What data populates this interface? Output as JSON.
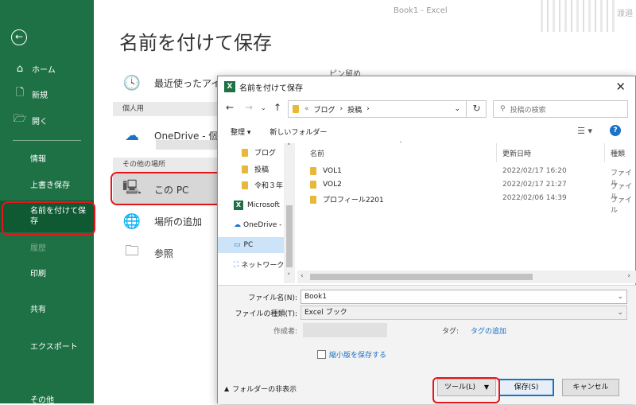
{
  "window_title": "Book1  -  Excel",
  "top_right_text": "渡邉",
  "page_title": "名前を付けて保存",
  "sidebar": {
    "home": "ホーム",
    "new": "新規",
    "open": "開く",
    "info": "情報",
    "overwrite": "上書き保存",
    "save_as": "名前を付けて保\n存",
    "history": "履歴",
    "print": "印刷",
    "share": "共有",
    "export": "エクスポート",
    "other": "その他"
  },
  "locations": {
    "recent": "最近使ったアイテム",
    "personal_header": "個人用",
    "onedrive": "OneDrive - 個人用",
    "other_header": "その他の場所",
    "this_pc": "この PC",
    "add_place": "場所の追加",
    "browse": "参照",
    "pin_label": "ピン留め"
  },
  "dialog": {
    "title": "名前を付けて保存",
    "path": [
      "«",
      "ブログ",
      "投稿"
    ],
    "search_placeholder": "投稿の検索",
    "toolbar": {
      "organize": "整理 ▾",
      "new_folder": "新しいフォルダー"
    },
    "tree": [
      "ブログ",
      "投稿",
      "令和３年",
      "Microsoft",
      "OneDrive -",
      "PC",
      "ネットワーク"
    ],
    "columns": {
      "name": "名前",
      "date": "更新日時",
      "type": "種類"
    },
    "files": [
      {
        "name": "VOL1",
        "date": "2022/02/17 16:20",
        "type": "ファイル"
      },
      {
        "name": "VOL2",
        "date": "2022/02/17 21:27",
        "type": "ファイル"
      },
      {
        "name": "プロフィール2201",
        "date": "2022/02/06 14:39",
        "type": "ファイル"
      }
    ],
    "filename_label": "ファイル名(N):",
    "filename_value": "Book1",
    "filetype_label": "ファイルの種類(T):",
    "filetype_value": "Excel ブック",
    "author_label": "作成者:",
    "tag_label": "タグ:",
    "tag_link": "タグの追加",
    "thumbnail_label": "縮小版を保存する",
    "hide_folders": "フォルダーの非表示",
    "tools_button": "ツール(L)",
    "save_button": "保存(S)",
    "cancel_button": "キャンセル"
  },
  "colors": {
    "excel_green": "#1e7145",
    "highlight_red": "#e8141c",
    "link_blue": "#1a6fc4"
  }
}
